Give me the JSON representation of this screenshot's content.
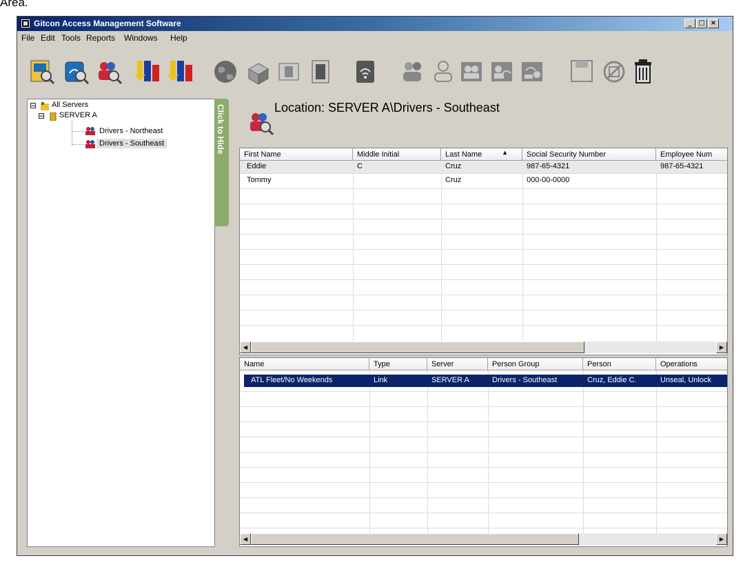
{
  "page": {
    "top_text": "Area."
  },
  "window": {
    "title": "Gitcon Access Management Software",
    "min": "_",
    "max": "□",
    "close": "×"
  },
  "menu": {
    "items": [
      "File",
      "Edit",
      "Tools",
      "Reports",
      "Windows",
      "Help"
    ]
  },
  "tree": {
    "root": "All Servers",
    "server": "SERVER A",
    "groups": [
      "Drivers - Northeast",
      "Drivers - Southeast"
    ],
    "selected_group": "Drivers - Southeast",
    "expand_root": "⊟",
    "expand_server": "⊟"
  },
  "hide_tab": {
    "label": "Click to Hide"
  },
  "location": {
    "title": "Location: SERVER A\\Drivers - Southeast"
  },
  "persons_table": {
    "columns": [
      "First Name",
      "Middle Initial",
      "Last Name",
      "Social Security Number",
      "Employee Num"
    ],
    "sorted_column": "Last Name",
    "rows": [
      [
        "Eddie",
        "C",
        "Cruz",
        "987-65-4321",
        "987-65-4321"
      ],
      [
        "Tommy",
        "",
        "Cruz",
        "000-00-0000",
        ""
      ]
    ]
  },
  "links_table": {
    "columns": [
      "Name",
      "Type",
      "Server",
      "Person Group",
      "Person",
      "Operations"
    ],
    "rows": [
      [
        "ATL Fleet/No Weekends",
        "Link",
        "SERVER A",
        "Drivers - Southeast",
        "Cruz, Eddie  C.",
        "Unseal, Unlock"
      ]
    ]
  },
  "colors": {
    "title_gradient_start": "#0a246a",
    "selection": "#0a246a",
    "hide_tab": "#8cab6d"
  }
}
